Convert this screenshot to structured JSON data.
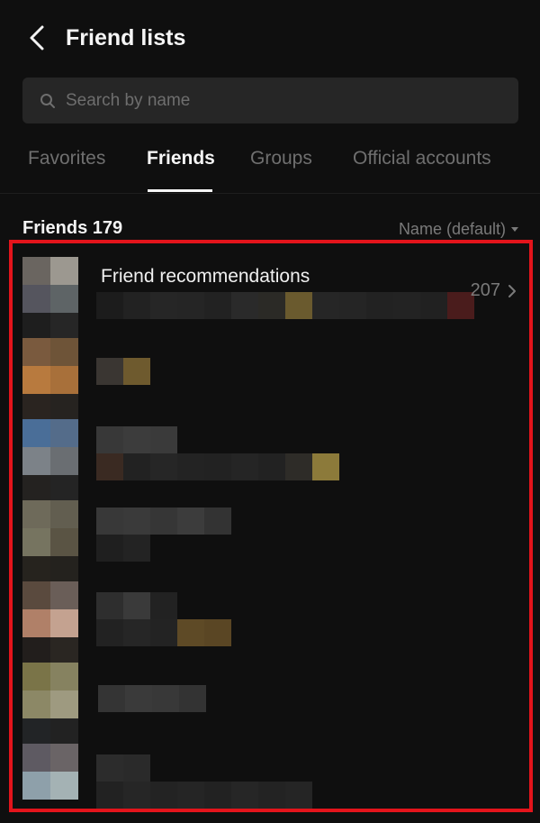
{
  "header": {
    "title": "Friend lists",
    "back_icon": "chevron-left-icon"
  },
  "search": {
    "placeholder": "Search by name",
    "icon": "search-icon"
  },
  "tabs": [
    {
      "label": "Favorites",
      "active": false
    },
    {
      "label": "Friends",
      "active": true
    },
    {
      "label": "Groups",
      "active": false
    },
    {
      "label": "Official accounts",
      "active": false
    }
  ],
  "friends_section": {
    "title": "Friends 179",
    "sort_label": "Name (default)"
  },
  "recommendations": {
    "label": "Friend recommendations",
    "count": "207"
  },
  "colors": {
    "background": "#0f0f0f",
    "highlight_border": "#e3141b",
    "search_background": "#262626"
  }
}
